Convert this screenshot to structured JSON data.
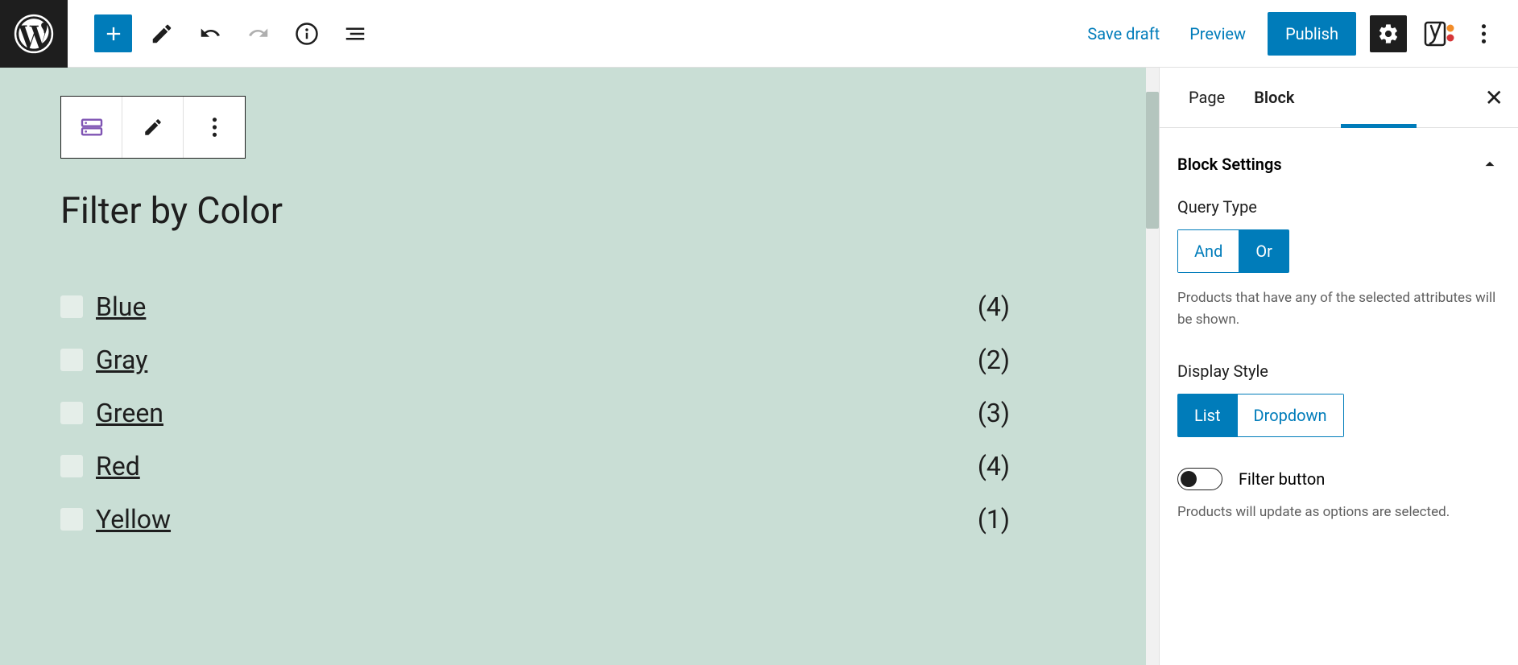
{
  "topbar": {
    "save_draft": "Save draft",
    "preview": "Preview",
    "publish": "Publish"
  },
  "sidebar": {
    "tabs": {
      "page": "Page",
      "block": "Block",
      "active": "Block"
    },
    "panel_title": "Block Settings",
    "query_type": {
      "label": "Query Type",
      "options": {
        "and": "And",
        "or": "Or"
      },
      "selected": "Or",
      "help": "Products that have any of the selected attributes will be shown."
    },
    "display_style": {
      "label": "Display Style",
      "options": {
        "list": "List",
        "dropdown": "Dropdown"
      },
      "selected": "List"
    },
    "filter_button": {
      "label": "Filter button",
      "enabled": false,
      "help": "Products will update as options are selected."
    }
  },
  "block": {
    "heading": "Filter by Color",
    "items": [
      {
        "label": "Blue",
        "count": "(4)"
      },
      {
        "label": "Gray",
        "count": "(2)"
      },
      {
        "label": "Green",
        "count": "(3)"
      },
      {
        "label": "Red",
        "count": "(4)"
      },
      {
        "label": "Yellow",
        "count": "(1)"
      }
    ]
  }
}
